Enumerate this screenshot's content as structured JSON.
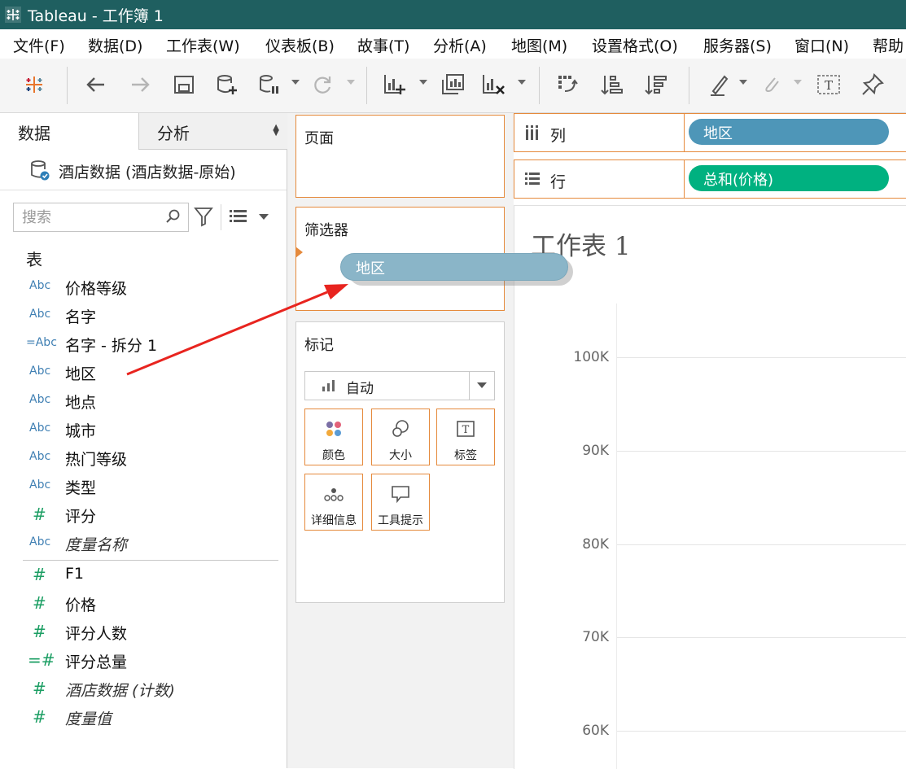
{
  "window": {
    "title": "Tableau - 工作簿 1"
  },
  "menu": [
    "文件(F)",
    "数据(D)",
    "工作表(W)",
    "仪表板(B)",
    "故事(T)",
    "分析(A)",
    "地图(M)",
    "设置格式(O)",
    "服务器(S)",
    "窗口(N)",
    "帮助"
  ],
  "left_panel": {
    "tabs": {
      "data": "数据",
      "analysis": "分析"
    },
    "datasource": "酒店数据 (酒店数据-原始)",
    "search_placeholder": "搜索",
    "tables_heading": "表",
    "dimensions": [
      {
        "type": "Abc",
        "name": "价格等级"
      },
      {
        "type": "Abc",
        "name": "名字"
      },
      {
        "type": "=Abc",
        "name": "名字 - 拆分 1"
      },
      {
        "type": "Abc",
        "name": "地区"
      },
      {
        "type": "Abc",
        "name": "地点"
      },
      {
        "type": "Abc",
        "name": "城市"
      },
      {
        "type": "Abc",
        "name": "热门等级"
      },
      {
        "type": "Abc",
        "name": "类型"
      },
      {
        "type": "#",
        "name": "评分"
      },
      {
        "type": "Abc",
        "name": "度量名称"
      }
    ],
    "measures": [
      {
        "type": "#",
        "name": "F1"
      },
      {
        "type": "#",
        "name": "价格"
      },
      {
        "type": "#",
        "name": "评分人数"
      },
      {
        "type": "=#",
        "name": "评分总量"
      },
      {
        "type": "#",
        "name": "酒店数据 (计数)"
      },
      {
        "type": "#",
        "name": "度量值"
      }
    ]
  },
  "cards": {
    "pages": "页面",
    "filters": "筛选器",
    "marks": "标记",
    "marks_type": "自动",
    "mark_buttons": [
      "颜色",
      "大小",
      "标签",
      "详细信息",
      "工具提示"
    ]
  },
  "shelves": {
    "columns_label": "列",
    "columns_pill": "地区",
    "rows_label": "行",
    "rows_pill": "总和(价格)"
  },
  "drag_pill": "地区",
  "sheet": {
    "title": "工作表 1",
    "y_ticks": [
      "100K",
      "90K",
      "80K",
      "70K",
      "60K"
    ]
  },
  "colors": {
    "title_bar": "#1f5f60",
    "dimension_pill": "#4e96b8",
    "measure_pill": "#00b180",
    "shelf_border": "#e58a3c",
    "annotation_arrow": "#e8241f"
  }
}
